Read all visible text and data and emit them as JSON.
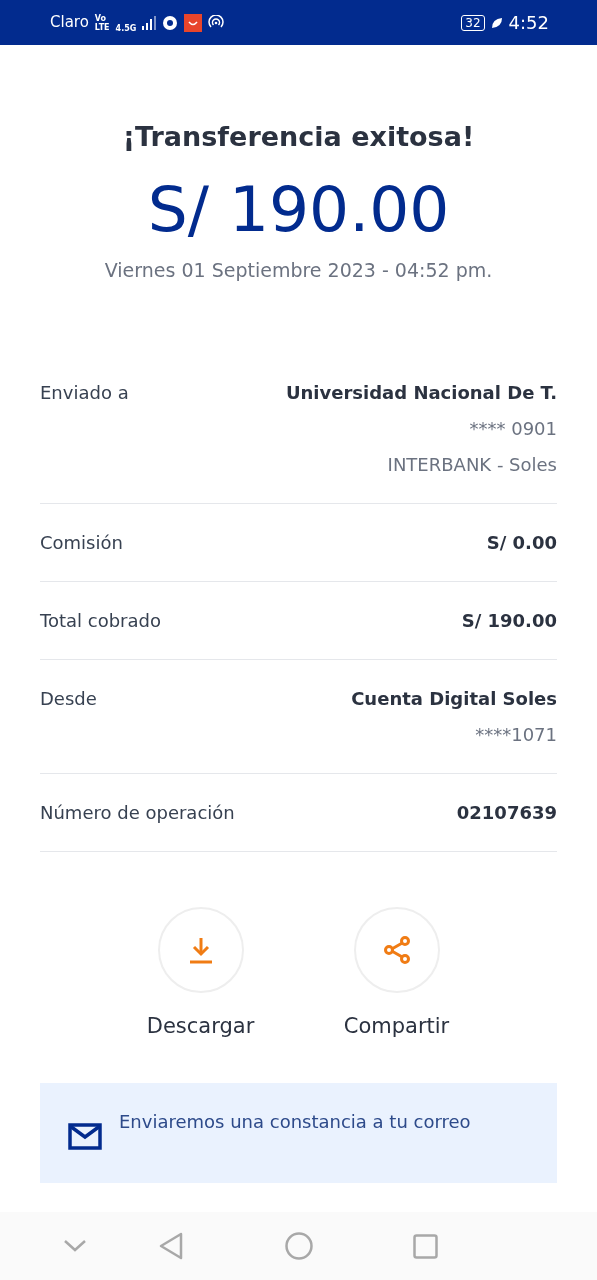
{
  "status_bar": {
    "carrier": "Claro",
    "volte": [
      "Vo",
      "LTE"
    ],
    "network": "4.5G",
    "battery": "32",
    "time": "4:52"
  },
  "title": "¡Transferencia exitosa!",
  "amount": "S/ 190.00",
  "date": "Viernes 01 Septiembre 2023 - 04:52 pm.",
  "details": [
    {
      "label": "Enviado a",
      "values": [
        {
          "text": "Universidad Nacional De T.",
          "emphasis": true
        },
        {
          "text": "**** 0901",
          "emphasis": false
        },
        {
          "text": "INTERBANK - Soles",
          "emphasis": false
        }
      ]
    },
    {
      "label": "Comisión",
      "values": [
        {
          "text": "S/ 0.00",
          "emphasis": true
        }
      ]
    },
    {
      "label": "Total cobrado",
      "values": [
        {
          "text": "S/ 190.00",
          "emphasis": true
        }
      ]
    },
    {
      "label": "Desde",
      "values": [
        {
          "text": "Cuenta Digital Soles",
          "emphasis": true
        },
        {
          "text": "****1071",
          "emphasis": false
        }
      ]
    },
    {
      "label": "Número de operación",
      "values": [
        {
          "text": "02107639",
          "emphasis": true
        }
      ]
    }
  ],
  "actions": [
    {
      "label": "Descargar",
      "kind": "download"
    },
    {
      "label": "Compartir",
      "kind": "share"
    }
  ],
  "notice": "Enviaremos una constancia a tu correo"
}
